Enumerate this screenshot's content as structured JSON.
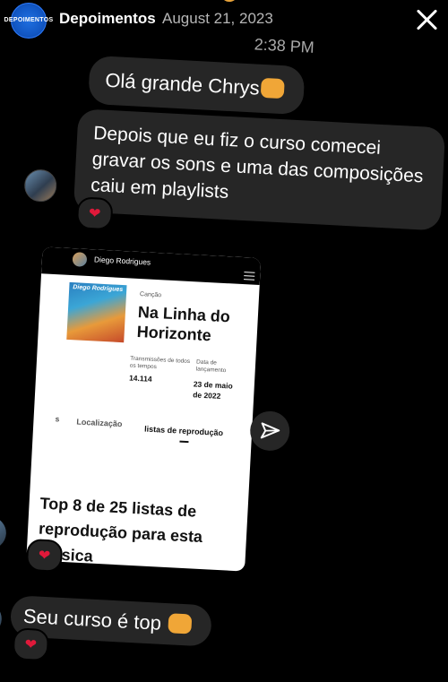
{
  "header": {
    "account_name": "Depoimentos",
    "date": "August 21, 2023",
    "avatar_text": "DEPOIMENTOS"
  },
  "messages": [
    {
      "text": "Olá grande Chrys",
      "emoji": "fist-emoji"
    },
    {
      "text": "Depois que eu fiz o curso comecei gravar os sons e uma das composições caiu em playlists",
      "reaction": "❤"
    },
    {
      "text": "Seu curso é top",
      "emoji": "fist-emoji",
      "reaction": "❤"
    }
  ],
  "timestamp": "2:38 PM",
  "shared_card": {
    "owner": "Diego Rodrigues",
    "cover_title": "Diego Rodrigues",
    "genre_label": "Canção",
    "song_title": "Na Linha do Horizonte",
    "plays_label": "Transmissões de todos os tempos",
    "plays_value": "14.114",
    "release_label": "Data de lançamento",
    "release_value": "23 de maio de 2022",
    "tabs": [
      "s",
      "Localização",
      "listas de reprodução"
    ],
    "headline": "Top 8 de 25 listas de reprodução para esta música"
  },
  "reactions": {
    "heart_1": "❤",
    "heart_2": "❤",
    "heart_3": "❤"
  },
  "colors": {
    "bubble": "#262626",
    "heart": "#e0193a",
    "background": "#000000"
  }
}
